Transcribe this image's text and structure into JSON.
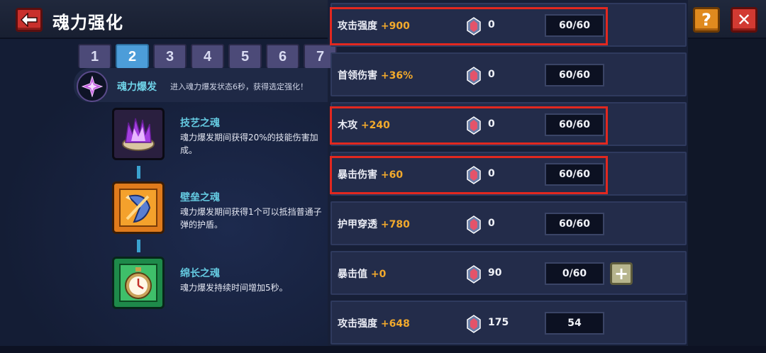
{
  "header": {
    "title": "魂力强化",
    "help_label": "?",
    "close_label": "✕"
  },
  "tabs": [
    {
      "label": "1",
      "active": false
    },
    {
      "label": "2",
      "active": true
    },
    {
      "label": "3",
      "active": false
    },
    {
      "label": "4",
      "active": false
    },
    {
      "label": "5",
      "active": false
    },
    {
      "label": "6",
      "active": false
    },
    {
      "label": "7",
      "active": false
    }
  ],
  "burst": {
    "name": "魂力爆发",
    "description": "进入魂力爆发状态6秒，获得选定强化！"
  },
  "skills": [
    {
      "name": "技艺之魂",
      "description": "魂力爆发期间获得20%的技能伤害加成。",
      "icon": "crystal-flame-icon"
    },
    {
      "name": "壁垒之魂",
      "description": "魂力爆发期间获得1个可以抵挡普通子弹的护盾。",
      "icon": "shield-icon"
    },
    {
      "name": "绵长之魂",
      "description": "魂力爆发持续时间增加5秒。",
      "icon": "stopwatch-icon"
    }
  ],
  "stats": [
    {
      "name": "攻击强度",
      "bonus": "+900",
      "gems": "0",
      "level": "60/60",
      "plus": false,
      "highlight": true
    },
    {
      "name": "首领伤害",
      "bonus": "+36%",
      "gems": "0",
      "level": "60/60",
      "plus": false,
      "highlight": false
    },
    {
      "name": "木攻",
      "bonus": "+240",
      "gems": "0",
      "level": "60/60",
      "plus": false,
      "highlight": true
    },
    {
      "name": "暴击伤害",
      "bonus": "+60",
      "gems": "0",
      "level": "60/60",
      "plus": false,
      "highlight": true
    },
    {
      "name": "护甲穿透",
      "bonus": "+780",
      "gems": "0",
      "level": "60/60",
      "plus": false,
      "highlight": false
    },
    {
      "name": "暴击值",
      "bonus": "+0",
      "gems": "90",
      "level": "0/60",
      "plus": true,
      "highlight": false
    },
    {
      "name": "攻击强度",
      "bonus": "+648",
      "gems": "175",
      "level": "54",
      "plus": false,
      "highlight": false
    }
  ],
  "plus_label": "+",
  "colors": {
    "highlight": "#e2281f",
    "bonus": "#f1a92c",
    "skill_name": "#64c9e0",
    "active_tab": "#4c9dd9"
  }
}
